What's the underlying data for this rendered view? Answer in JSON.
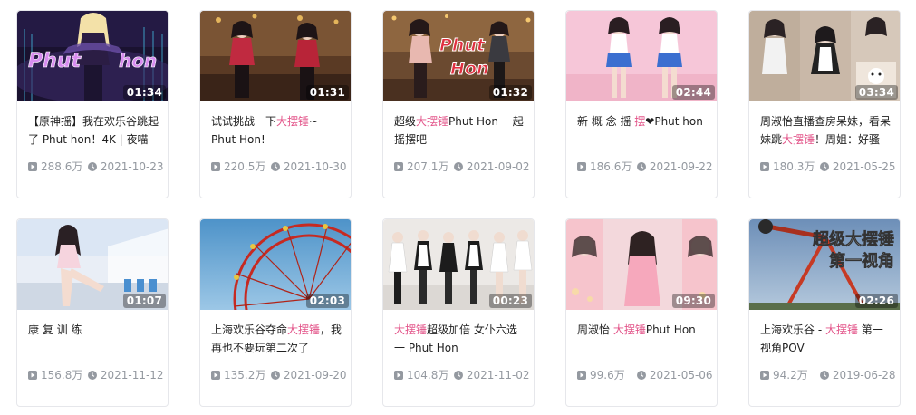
{
  "colors": {
    "accent": "#e3558a",
    "meta": "#9499a0",
    "border": "#e6e7eb"
  },
  "videos": [
    {
      "duration": "01:34",
      "pre": "【原神摇】我在欢乐谷跳起了 Phut hon！4K | 夜喵",
      "hl": "",
      "post": "",
      "views": "288.6万",
      "date": "2021-10-23",
      "thumb_text": [
        "Phut",
        "hon"
      ]
    },
    {
      "duration": "01:31",
      "pre": "试试挑战一下",
      "hl": "大摆锤",
      "post": "~ Phut Hon!",
      "views": "220.5万",
      "date": "2021-10-30",
      "thumb_text": []
    },
    {
      "duration": "01:32",
      "pre": "超级",
      "hl": "大摆锤",
      "post": "Phut Hon 一起摇摆吧",
      "views": "207.1万",
      "date": "2021-09-02",
      "thumb_text": [
        "Phut",
        "Hon"
      ]
    },
    {
      "duration": "02:44",
      "pre": "新 概 念 摇 ",
      "hl": "摆",
      "post": "❤Phut hon",
      "views": "186.6万",
      "date": "2021-09-22",
      "thumb_text": []
    },
    {
      "duration": "03:34",
      "pre": "周淑怡直播查房呆妹，看呆妹跳",
      "hl": "大摆锤",
      "post": "！周姐：好骚",
      "views": "180.3万",
      "date": "2021-05-25",
      "thumb_text": []
    },
    {
      "duration": "01:07",
      "pre": "康 复 训 练",
      "hl": "",
      "post": "",
      "views": "156.8万",
      "date": "2021-11-12",
      "thumb_text": []
    },
    {
      "duration": "02:03",
      "pre": "上海欢乐谷夺命",
      "hl": "大摆锤",
      "post": "，我再也不要玩第二次了",
      "views": "135.2万",
      "date": "2021-09-20",
      "thumb_text": []
    },
    {
      "duration": "00:23",
      "pre": "",
      "hl": "大摆锤",
      "post": "超级加倍 女仆六选一 Phut Hon",
      "views": "104.8万",
      "date": "2021-11-02",
      "thumb_text": []
    },
    {
      "duration": "09:30",
      "pre": "周淑怡 ",
      "hl": "大摆锤",
      "post": "Phut Hon",
      "views": "99.6万",
      "date": "2021-05-06",
      "thumb_text": []
    },
    {
      "duration": "02:26",
      "pre": "上海欢乐谷 - ",
      "hl": "大摆锤",
      "post": " 第一视角POV",
      "views": "94.2万",
      "date": "2019-06-28",
      "thumb_text": [
        "超级大摆锤",
        "第一视角"
      ]
    }
  ]
}
